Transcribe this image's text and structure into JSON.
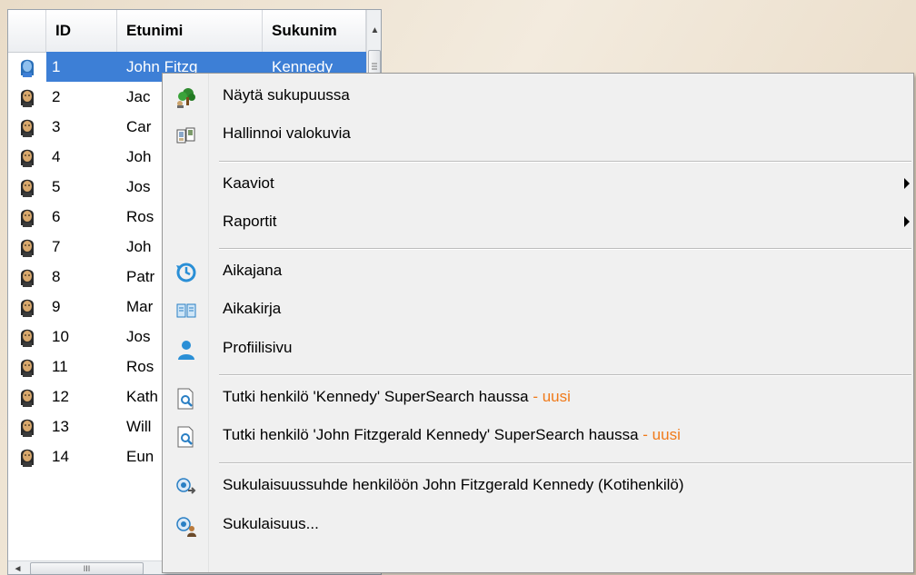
{
  "grid": {
    "columns": [
      "ID",
      "Etunimi",
      "Sukunim"
    ],
    "rows": [
      {
        "id": "1",
        "first": "John Fitzg",
        "last": "Kennedy",
        "selected": true
      },
      {
        "id": "2",
        "first": "Jac",
        "last": ""
      },
      {
        "id": "3",
        "first": "Car",
        "last": ""
      },
      {
        "id": "4",
        "first": "Joh",
        "last": ""
      },
      {
        "id": "5",
        "first": "Jos",
        "last": ""
      },
      {
        "id": "6",
        "first": "Ros",
        "last": ""
      },
      {
        "id": "7",
        "first": "Joh",
        "last": ""
      },
      {
        "id": "8",
        "first": "Patr",
        "last": ""
      },
      {
        "id": "9",
        "first": "Mar",
        "last": ""
      },
      {
        "id": "10",
        "first": "Jos",
        "last": ""
      },
      {
        "id": "11",
        "first": "Ros",
        "last": ""
      },
      {
        "id": "12",
        "first": "Kath",
        "last": ""
      },
      {
        "id": "13",
        "first": "Will",
        "last": ""
      },
      {
        "id": "14",
        "first": "Eun",
        "last": ""
      }
    ],
    "hscroll_grip": "III"
  },
  "menu": {
    "show_in_tree": "Näytä sukupuussa",
    "manage_photos": "Hallinnoi valokuvia",
    "charts": "Kaaviot",
    "reports": "Raportit",
    "timeline": "Aikajana",
    "chronicle": "Aikakirja",
    "profile_page": "Profiilisivu",
    "search_surname": "Tutki henkilö 'Kennedy' SuperSearch haussa",
    "search_fullname": "Tutki henkilö 'John Fitzgerald Kennedy' SuperSearch haussa",
    "new_tag": " - uusi",
    "relationship_home": "Sukulaisuussuhde henkilöön John Fitzgerald Kennedy (Kotihenkilö)",
    "relationship": "Sukulaisuus...",
    "new_color": "#f07a1a"
  }
}
